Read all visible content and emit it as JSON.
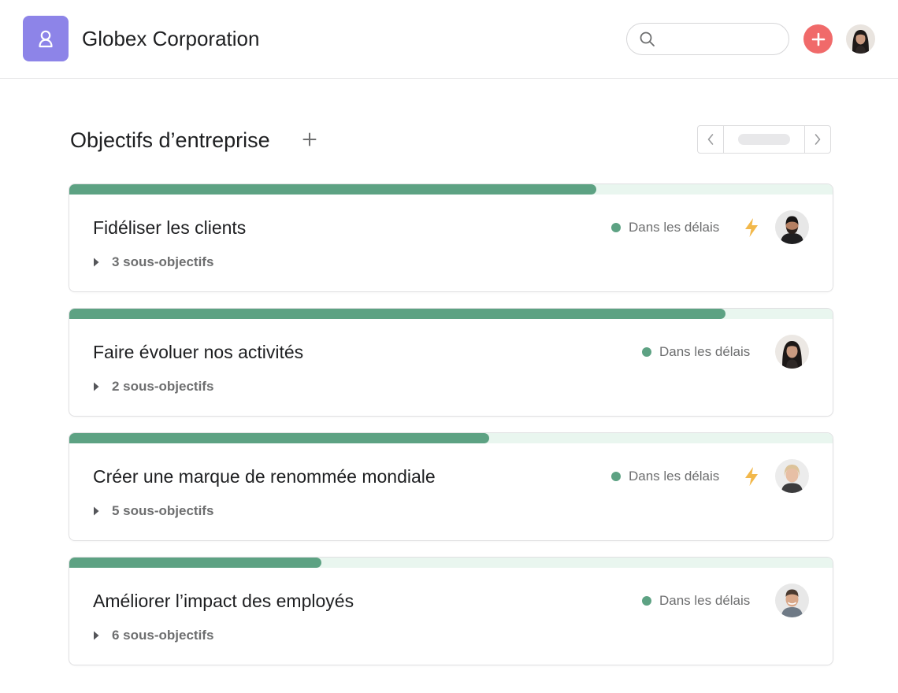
{
  "header": {
    "org_name": "Globex Corporation",
    "logo_icon": "user-outline-icon",
    "search": {
      "placeholder": "",
      "value": ""
    },
    "accent_add": "#f06a6a",
    "logo_color": "#8d84e8"
  },
  "section": {
    "title": "Objectifs d’entreprise"
  },
  "colors": {
    "progress_fill": "#5da283",
    "progress_track": "#e9f6ef",
    "status_dot": "#5da283",
    "bolt": "#f2b84b"
  },
  "goals": [
    {
      "title": "Fidéliser les clients",
      "subgoals": "3 sous-objectifs",
      "status": "Dans les délais",
      "progress": 0.69,
      "bolt": true,
      "owner": "man-dark-hair-beard"
    },
    {
      "title": "Faire évoluer nos activités",
      "subgoals": "2 sous-objectifs",
      "status": "Dans les délais",
      "progress": 0.86,
      "bolt": false,
      "owner": "woman-long-dark-hair"
    },
    {
      "title": "Créer une marque de renommée mondiale",
      "subgoals": "5 sous-objectifs",
      "status": "Dans les délais",
      "progress": 0.55,
      "bolt": true,
      "owner": "woman-blonde-short-hair"
    },
    {
      "title": "Améliorer l’impact des employés",
      "subgoals": "6 sous-objectifs",
      "status": "Dans les délais",
      "progress": 0.33,
      "bolt": false,
      "owner": "man-smiling"
    }
  ]
}
